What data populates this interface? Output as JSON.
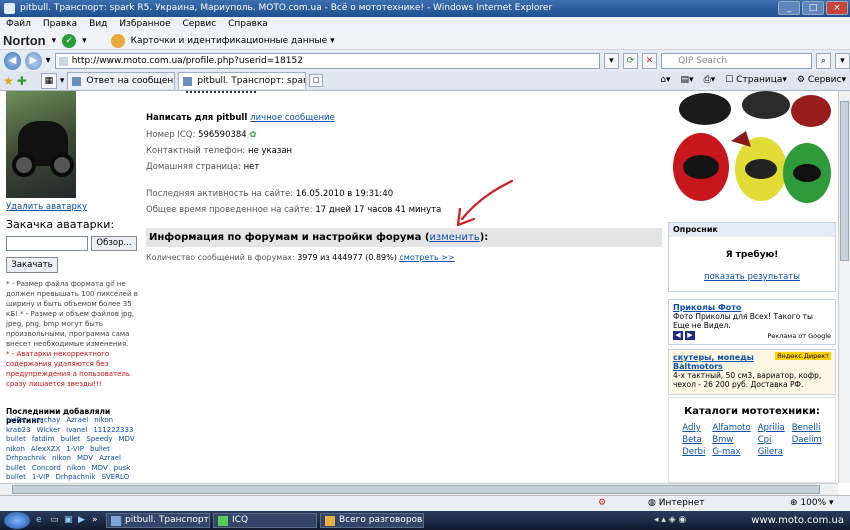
{
  "window": {
    "title": "pitbull. Транспорт: spark R5. Украина, Мариуполь. MOTO.com.ua - Всё о мототехнике! - Windows Internet Explorer",
    "controls": [
      "_",
      "□",
      "×"
    ]
  },
  "menu": [
    "Файл",
    "Правка",
    "Вид",
    "Избранное",
    "Сервис",
    "Справка"
  ],
  "norton": {
    "logo": "Norton",
    "dropdown": "▾",
    "identity_label": "Карточки и идентификационные данные"
  },
  "address": {
    "url": "http://www.moto.com.ua/profile.php?userid=18152",
    "search_placeholder": "QIP Search"
  },
  "tabs": [
    {
      "label": "Ответ на сообщение в фор..."
    },
    {
      "label": "pitbull. Транспорт: spark..."
    }
  ],
  "toolbar_right": {
    "page": "Страница",
    "tools": "Сервис"
  },
  "left": {
    "delete_avatar": "Удалить аватарку",
    "upload_title": "Закачка аватарки:",
    "browse_button": "Обзор...",
    "upload_button": "Закачать",
    "rules": "* - Размер файла формата gif не должен превышать 100 пикселей в ширину и быть объемом более 35 кБ! * - Размер и объем файлов jpg, jpeg, png, bmp могут быть произвольными, программа сама внесет необходимые изменения.",
    "warning": "* - Аватарки некорректного содержания удаляются без предупреждения а пользователь сразу лишается звезды!!!",
    "rating_title": "Последними добавляли рейтинг:",
    "nicks": [
      "bullet",
      "pruchay",
      "Azrael",
      "nikon",
      "krab23",
      "Wicker",
      "Ivanel",
      "111222333",
      "bullet",
      "fatdim",
      "bullet",
      "Speedy",
      "MDV",
      "nikon",
      "AlexXZX",
      "1-VIP",
      "bullet",
      "Drhpachnik",
      "nikon",
      "MDV",
      "Azrael",
      "bullet",
      "Concord",
      "nikon",
      "MDV",
      "pusk",
      "bullet",
      "1-VIP",
      "Drhpachnik",
      "SVERLO",
      "nikon",
      "MDV"
    ]
  },
  "profile": {
    "write_label": "Написать для pitbull",
    "pm_link": "личное сообщение",
    "icq_label": "Номер ICQ:",
    "icq_value": "596590384",
    "phone_label": "Контактный телефон:",
    "phone_value": "не указан",
    "homepage_label": "Домашняя страница:",
    "homepage_value": "нет",
    "last_activity_label": "Последняя активность на сайте:",
    "last_activity_value": "16.05.2010 в 19:31:40",
    "total_time_label": "Общее время проведенное на сайте:",
    "total_time_value": "17 дней 17 часов 41 минута",
    "forum_section_prefix": "Информация по форумам и настройки форума (",
    "forum_section_link": "изменить",
    "forum_section_suffix": "):",
    "posts_label": "Количество сообщений в форумах:",
    "posts_value": "3979 из 444977 (0.89%)",
    "view_link": "смотреть >>"
  },
  "right": {
    "poll_head": "Опросник",
    "poll_text": "Я требую!",
    "poll_results": "показать результаты",
    "ad1_title": "Приколы Фото",
    "ad1_text": "Фото Приколы для Всех! Такого ты Еще не Видел.",
    "ad1_google": "Реклама от Google",
    "ad2_title": "скутеры, мопеды Baltmotors",
    "ad2_badge": "Яндекс.Директ",
    "ad2_text": "4-х тактный, 50 см3, вариатор, кофр, чехол - 26 200 руб. Доставка РФ.",
    "catalog_title": "Каталоги мототехники:",
    "brands": [
      "Adly",
      "Alfamoto",
      "Aprilia",
      "Benelli",
      "Beta",
      "Bmw",
      "Cpi",
      "Daelim",
      "Derbi",
      "G-max",
      "Gilera"
    ]
  },
  "status": {
    "zone": "Интернет",
    "zoom": "100%"
  },
  "taskbar": {
    "items": [
      "pitbull. Транспорт:...",
      "ICQ",
      "Всего разговоров: ..."
    ],
    "watermark": "www.moto.com.ua"
  },
  "colors": {
    "link": "#0b4fb0",
    "warning": "#d01010",
    "arrow": "#d11a1a"
  }
}
